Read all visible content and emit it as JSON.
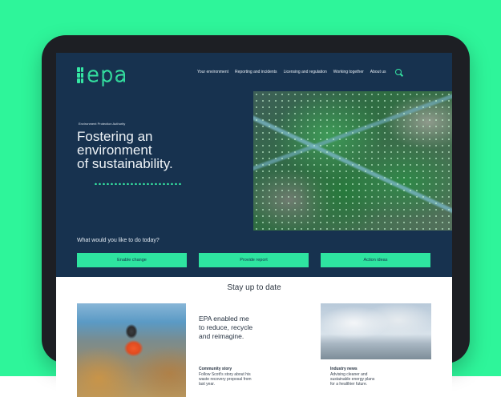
{
  "brand": {
    "logo_text": "epa",
    "agency_label": "Environment Protection Authority",
    "colors": {
      "accent": "#35e6a3",
      "hero_bg": "#17324f",
      "page_bg": "#2ef59a"
    }
  },
  "nav": {
    "items": [
      "Your environment",
      "Reporting and incidents",
      "Licensing and regulation",
      "Working together",
      "About us"
    ],
    "search_icon": "search-icon"
  },
  "hero": {
    "headline_lines": [
      "Fostering an",
      "environment",
      "of sustainability."
    ],
    "question": "What would you like to do today?",
    "buttons": [
      "Enable change",
      "Provide report",
      "Action ideas"
    ]
  },
  "updates": {
    "title": "Stay up to date",
    "main_card": {
      "quote_lines": [
        "EPA enabled me",
        "to reduce, recycle",
        "and reimagine."
      ],
      "story_title": "Community story",
      "story_body_lines": [
        "Follow Scott's story about his",
        "waste recovery proposal from",
        "last year."
      ]
    },
    "side_card": {
      "title": "Industry news",
      "body_lines": [
        "Advising cleaner and",
        "sustainable energy plans",
        "for a healthier future."
      ]
    }
  }
}
